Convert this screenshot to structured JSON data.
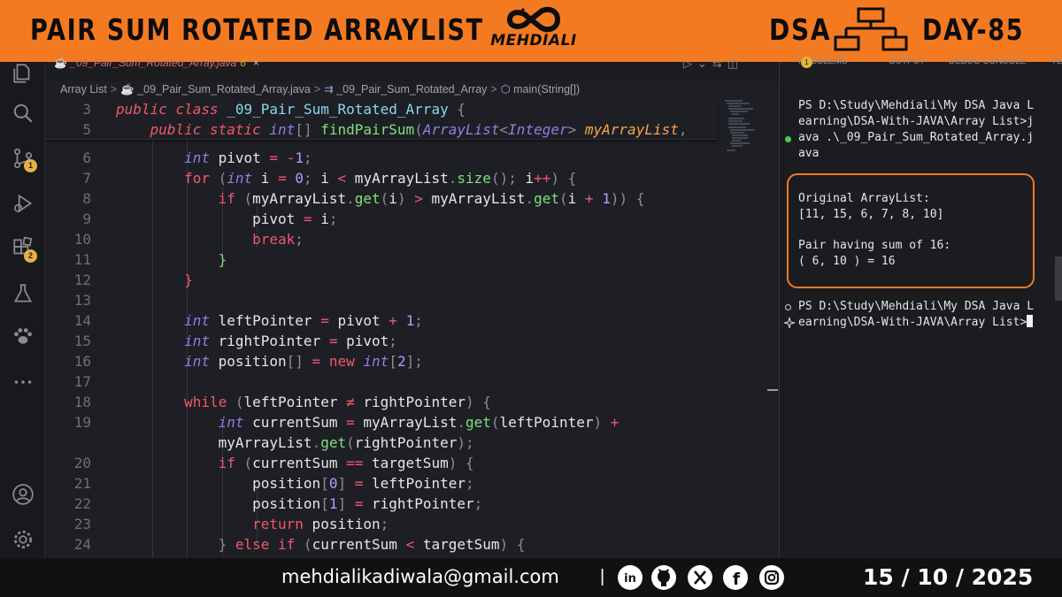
{
  "banner": {
    "title": "PAIR SUM ROTATED ARRAYLIST",
    "logo_text": "MEHDIALI",
    "topic": "DSA",
    "day": "DAY-85",
    "accent_color": "#f47a22"
  },
  "activity_bar": {
    "items": [
      "explorer-icon",
      "search-icon",
      "source-control-icon",
      "run-debug-icon",
      "extensions-icon",
      "testing-icon",
      "paw-icon",
      "more-icon"
    ],
    "source_control_badge": "1",
    "extensions_badge": "2",
    "bottom_items": [
      "account-icon",
      "settings-gear-icon"
    ]
  },
  "editor": {
    "tab": {
      "filename": "_09_Pair_Sum_Rotated_Array.java",
      "problems": "6",
      "close": "×"
    },
    "breadcrumb": {
      "folder": "Array List",
      "file": "_09_Pair_Sum_Rotated_Array.java",
      "class": "_09_Pair_Sum_Rotated_Array",
      "method": "main(String[])"
    },
    "line_numbers": [
      "3",
      "5",
      "6",
      "7",
      "8",
      "9",
      "10",
      "11",
      "12",
      "13",
      "14",
      "15",
      "16",
      "17",
      "18",
      "19",
      "",
      "20",
      "21",
      "22",
      "23",
      "24"
    ]
  },
  "terminal": {
    "tabs": {
      "problems": "PROBLEMS",
      "problems_count": "1",
      "output": "OUTPUT",
      "debug": "DEBUG CONSOLE",
      "terminal": "TE"
    },
    "command_lines": [
      "PS D:\\Study\\Mehdiali\\My DSA Java L",
      "earning\\DSA-With-JAVA\\Array List>j",
      "ava .\\_09_Pair_Sum_Rotated_Array.j",
      "ava"
    ],
    "output_label_1": "Original ArrayList:",
    "output_array": "[11, 15, 6, 7, 8, 10]",
    "output_label_2": "Pair having sum of 16:",
    "output_pair": "( 6, 10 ) = 16",
    "prompt_lines": [
      "PS D:\\Study\\Mehdiali\\My DSA Java L",
      "earning\\DSA-With-JAVA\\Array List>"
    ]
  },
  "footer": {
    "email": "mehdialikadiwala@gmail.com",
    "separator": "|",
    "socials": [
      "linkedin-icon",
      "github-icon",
      "x-icon",
      "facebook-icon",
      "instagram-icon"
    ],
    "date": "15 / 10 / 2025"
  }
}
